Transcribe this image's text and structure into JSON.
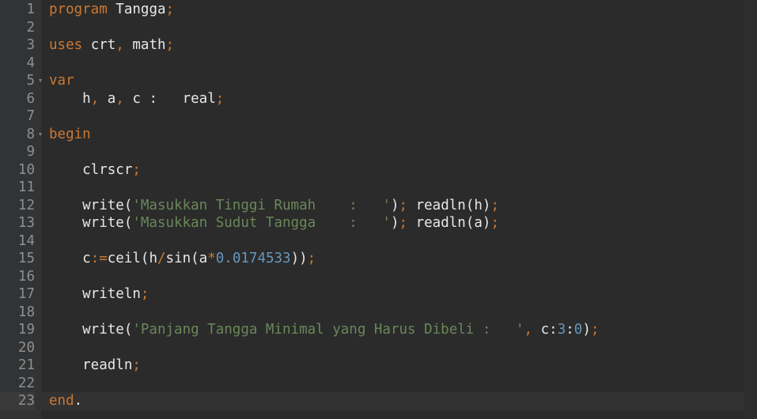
{
  "editor": {
    "lines": [
      {
        "n": "1",
        "fold": "",
        "tokens": [
          [
            "kw",
            "program"
          ],
          [
            "id",
            " Tangga"
          ],
          [
            "op",
            ";"
          ]
        ]
      },
      {
        "n": "2",
        "fold": "",
        "tokens": []
      },
      {
        "n": "3",
        "fold": "",
        "tokens": [
          [
            "kw",
            "uses"
          ],
          [
            "id",
            " crt"
          ],
          [
            "op",
            ","
          ],
          [
            "id",
            " math"
          ],
          [
            "op",
            ";"
          ]
        ]
      },
      {
        "n": "4",
        "fold": "",
        "tokens": []
      },
      {
        "n": "5",
        "fold": "▾",
        "tokens": [
          [
            "kw",
            "var"
          ]
        ]
      },
      {
        "n": "6",
        "fold": "",
        "tokens": [
          [
            "id",
            "    h"
          ],
          [
            "op",
            ","
          ],
          [
            "id",
            " a"
          ],
          [
            "op",
            ","
          ],
          [
            "id",
            " c :   real"
          ],
          [
            "op",
            ";"
          ]
        ]
      },
      {
        "n": "7",
        "fold": "",
        "tokens": []
      },
      {
        "n": "8",
        "fold": "▾",
        "tokens": [
          [
            "kw",
            "begin"
          ]
        ]
      },
      {
        "n": "9",
        "fold": "",
        "tokens": []
      },
      {
        "n": "10",
        "fold": "",
        "tokens": [
          [
            "id",
            "    clrscr"
          ],
          [
            "op",
            ";"
          ]
        ]
      },
      {
        "n": "11",
        "fold": "",
        "tokens": []
      },
      {
        "n": "12",
        "fold": "",
        "tokens": [
          [
            "id",
            "    write("
          ],
          [
            "str",
            "'Masukkan Tinggi Rumah    :   '"
          ],
          [
            "id",
            ")"
          ],
          [
            "op",
            ";"
          ],
          [
            "id",
            " readln(h)"
          ],
          [
            "op",
            ";"
          ]
        ]
      },
      {
        "n": "13",
        "fold": "",
        "tokens": [
          [
            "id",
            "    write("
          ],
          [
            "str",
            "'Masukkan Sudut Tangga    :   '"
          ],
          [
            "id",
            ")"
          ],
          [
            "op",
            ";"
          ],
          [
            "id",
            " readln(a)"
          ],
          [
            "op",
            ";"
          ]
        ]
      },
      {
        "n": "14",
        "fold": "",
        "tokens": []
      },
      {
        "n": "15",
        "fold": "",
        "tokens": [
          [
            "id",
            "    c"
          ],
          [
            "op",
            ":="
          ],
          [
            "id",
            "ceil(h"
          ],
          [
            "op",
            "/"
          ],
          [
            "id",
            "sin(a"
          ],
          [
            "op",
            "*"
          ],
          [
            "num",
            "0.0174533"
          ],
          [
            "id",
            "))"
          ],
          [
            "op",
            ";"
          ]
        ]
      },
      {
        "n": "16",
        "fold": "",
        "tokens": []
      },
      {
        "n": "17",
        "fold": "",
        "tokens": [
          [
            "id",
            "    writeln"
          ],
          [
            "op",
            ";"
          ]
        ]
      },
      {
        "n": "18",
        "fold": "",
        "tokens": []
      },
      {
        "n": "19",
        "fold": "",
        "tokens": [
          [
            "id",
            "    write("
          ],
          [
            "str",
            "'Panjang Tangga Minimal yang Harus Dibeli :   '"
          ],
          [
            "op",
            ","
          ],
          [
            "id",
            " c:"
          ],
          [
            "num",
            "3"
          ],
          [
            "id",
            ":"
          ],
          [
            "num",
            "0"
          ],
          [
            "id",
            ")"
          ],
          [
            "op",
            ";"
          ]
        ]
      },
      {
        "n": "20",
        "fold": "",
        "tokens": []
      },
      {
        "n": "21",
        "fold": "",
        "tokens": [
          [
            "id",
            "    readln"
          ],
          [
            "op",
            ";"
          ]
        ]
      },
      {
        "n": "22",
        "fold": "",
        "tokens": []
      },
      {
        "n": "23",
        "fold": "",
        "tokens": [
          [
            "kw",
            "end"
          ],
          [
            "id",
            "."
          ]
        ]
      }
    ],
    "active_line": "23",
    "colors": {
      "background": "#2b2b2b",
      "keyword": "#cc7832",
      "string": "#6a8759",
      "number": "#6897bb",
      "identifier": "#e8e8e8",
      "line_number": "#8f8f8f"
    }
  }
}
